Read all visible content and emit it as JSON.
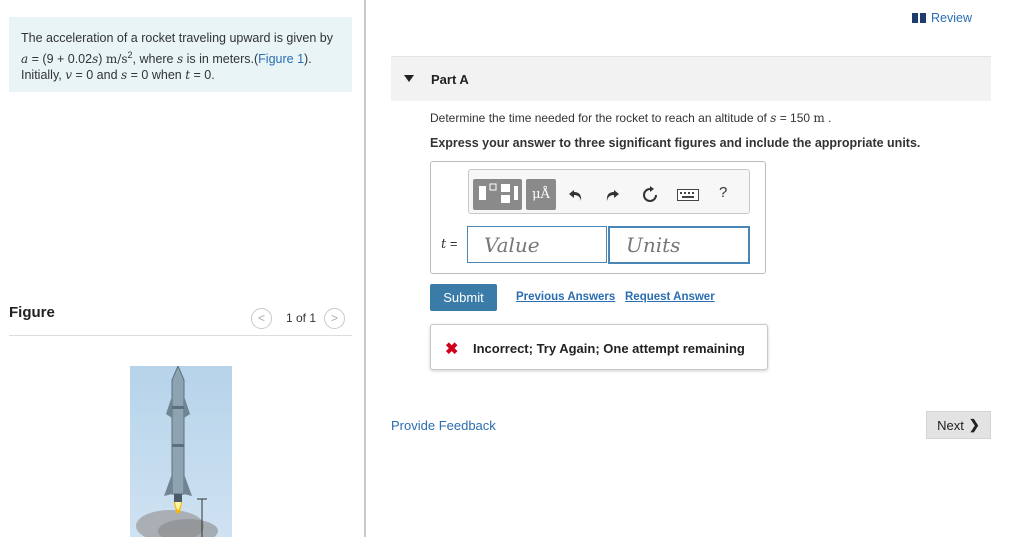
{
  "problem": {
    "line1": "The acceleration of a rocket traveling upward is given by",
    "a_var": "a",
    "eq_pre": " = (9 + 0.02",
    "s_var": "s",
    "eq_close": ") ",
    "unit_a": "m/s",
    "unit_a_exp": "2",
    "where_text": ", where ",
    "s_var2": "s",
    "meters_text": " is in meters.(",
    "figure_link": "Figure 1",
    "meters_close": ").",
    "line3_pre": "Initially, ",
    "v_var": "v",
    "eq_v": " = 0 and ",
    "s_var3": "s",
    "eq_s": " = 0 when ",
    "t_var": "t",
    "eq_t": " = 0."
  },
  "figure": {
    "label": "Figure",
    "count": "1 of 1",
    "prev": "<",
    "next": ">"
  },
  "header": {
    "review": "Review"
  },
  "part": {
    "label": "Part A",
    "question_pre": "Determine the time needed for the rocket to reach an altitude of ",
    "question_var": "s",
    "question_eq": " = 150 ",
    "question_unit": "m",
    "question_end": " .",
    "instruction": "Express your answer to three significant figures and include the appropriate units."
  },
  "answer": {
    "tb_mu": "μÅ",
    "tb_help": "?",
    "t_var": "t",
    "t_eq": " =",
    "value_placeholder": "Value",
    "units_placeholder": "Units"
  },
  "actions": {
    "submit": "Submit",
    "previous_answers": "Previous Answers",
    "request_answer": "Request Answer"
  },
  "feedback": {
    "icon": "✖",
    "message": "Incorrect; Try Again; One attempt remaining"
  },
  "footer": {
    "provide_feedback": "Provide Feedback",
    "next": "Next",
    "next_chev": "❯"
  },
  "colors": {
    "accent": "#2a6db1",
    "submit_bg": "#3b7ba8",
    "error": "#d0021b",
    "problem_bg": "#e8f4f6"
  }
}
